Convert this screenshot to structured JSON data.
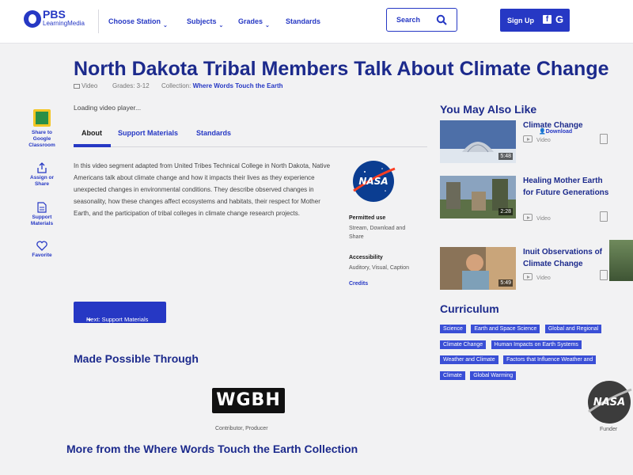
{
  "header": {
    "logo_main": "PBS",
    "logo_sub": "LearningMedia",
    "nav": [
      "Choose Station",
      "Subjects",
      "Grades",
      "Standards"
    ],
    "search_label": "Search",
    "signup_label": "Sign Up",
    "fb_label": "f",
    "google_label": "G"
  },
  "page": {
    "title": "North Dakota Tribal Members Talk About Climate Change",
    "media_type": "Video",
    "grades": "Grades: 3-12",
    "collection_label": "Collection:",
    "collection_link": "Where Words Touch the Earth",
    "loading": "Loading video player..."
  },
  "side_actions": [
    {
      "label": "Share to Google Classroom",
      "icon": "google-classroom-icon"
    },
    {
      "label": "Assign or Share",
      "icon": "share-icon"
    },
    {
      "label": "Support Materials",
      "icon": "document-icon"
    },
    {
      "label": "Favorite",
      "icon": "heart-icon"
    }
  ],
  "tabs": [
    "About",
    "Support Materials",
    "Standards"
  ],
  "about": {
    "description": "In this video segment adapted from United Tribes Technical College in North Dakota, Native Americans talk about climate change and how it impacts their lives as they experience unexpected changes in environmental conditions. They describe observed changes in seasonality, how these changes affect ecosystems and habitats, their respect for Mother Earth, and the participation of tribal colleges in climate change research projects.",
    "permitted_use_label": "Permitted use",
    "permitted_use": "Stream, Download and Share",
    "accessibility_label": "Accessibility",
    "accessibility": "Auditory, Visual, Caption",
    "credits": "Credits",
    "nasa_text": "NASA"
  },
  "next_button": "Next: Support Materials",
  "made_possible": {
    "heading": "Made Possible Through",
    "contributor_logo": "WGBH",
    "contributor_role": "Contributor, Producer",
    "funder_logo": "NASA",
    "funder_role": "Funder"
  },
  "more_heading": "More from the Where Words Touch the Earth Collection",
  "related": {
    "heading": "You May Also Like",
    "download": "Download",
    "items": [
      {
        "title": "Climate Change",
        "type": "Video",
        "duration": "5:48"
      },
      {
        "title": "Healing Mother Earth for Future Generations",
        "type": "Video",
        "duration": "2:28"
      },
      {
        "title": "Inuit Observations of Climate Change",
        "type": "Video",
        "duration": "5:49"
      }
    ]
  },
  "curriculum": {
    "heading": "Curriculum",
    "tags": [
      "Science",
      "Earth and Space Science",
      "Global and Regional Climate Change",
      "Human Impacts on Earth Systems",
      "Weather and Climate",
      "Factors that Influence Weather and Climate",
      "Global Warming"
    ]
  },
  "colors": {
    "brand": "#2638c4",
    "heading": "#1c2a8c",
    "background": "#f2f2f3"
  }
}
